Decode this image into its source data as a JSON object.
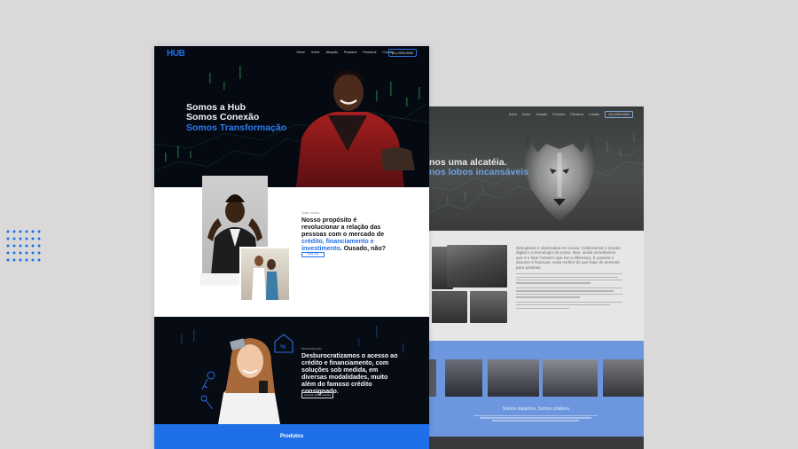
{
  "front": {
    "logo": "HUB",
    "nav": [
      "Home",
      "Sobre",
      "Atuação",
      "Produtos",
      "Parceiros",
      "Contato"
    ],
    "phone": "(11) 0000-0000",
    "hero": {
      "line1": "Somos a Hub",
      "line2": "Somos Conexão",
      "line3": "Somos Transformação"
    },
    "about": {
      "label": "Quem somos",
      "title_part1": "Nosso propósito é revolucionar a relação das pessoas com o mercado de ",
      "title_highlight": "crédito, financiamento e investimento",
      "title_part2": ". Ousado, não?",
      "button": "Saiba mais"
    },
    "services": {
      "label": "Nossa atuação",
      "title": "Desburocratizamos o acesso ao crédito e financiamento, com soluções sob medida, em diversas modalidades, muito além do famoso crédito consignado.",
      "button": "Conheça nossas soluções"
    },
    "products": {
      "title": "Produtos"
    }
  },
  "back": {
    "nav": [
      "Home",
      "Sobre",
      "Atuação",
      "Produtos",
      "Parceiros",
      "Contato"
    ],
    "phone": "(11) 0000-0000",
    "hero": {
      "line1": "nos uma alcatéia.",
      "line2": "nos lobos incansáveis"
    },
    "about_lead": "Disruptivos e obstinados em inovar. Celebramos o mundo digital e a tecnologia de ponta. Mas, ainda acreditamos que é o fator humano que faz a diferença. E quando o assunto é finanças, nada melhor do que falar de pessoas para pessoas.",
    "slogan": "Somos inquietos. Somos criativos."
  },
  "colors": {
    "brand_blue": "#1f6fe8",
    "hero_dark": "#050a12",
    "back_blue": "#6c96dd"
  }
}
